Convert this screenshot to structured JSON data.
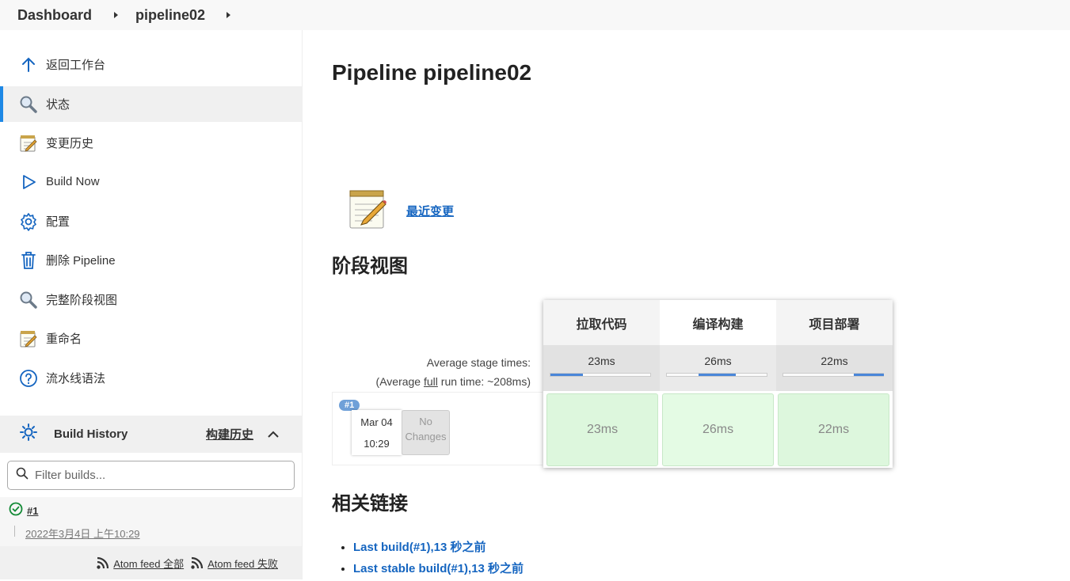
{
  "breadcrumb": {
    "items": [
      "Dashboard",
      "pipeline02"
    ]
  },
  "sidebar": {
    "items": [
      {
        "label": "返回工作台",
        "icon": "arrow-up-icon"
      },
      {
        "label": "状态",
        "icon": "magnifier-icon"
      },
      {
        "label": "变更历史",
        "icon": "notepad-icon"
      },
      {
        "label": "Build Now",
        "icon": "play-icon"
      },
      {
        "label": "配置",
        "icon": "gear-icon"
      },
      {
        "label": "删除 Pipeline",
        "icon": "trash-icon"
      },
      {
        "label": "完整阶段视图",
        "icon": "magnifier-icon"
      },
      {
        "label": "重命名",
        "icon": "notepad-icon"
      },
      {
        "label": "流水线语法",
        "icon": "help-icon"
      }
    ],
    "build_history": {
      "title": "Build History",
      "trend_label": "构建历史",
      "filter_placeholder": "Filter builds...",
      "builds": [
        {
          "number": "#1",
          "date": "2022年3月4日 上午10:29",
          "status": "success"
        }
      ],
      "feed_all": "Atom feed 全部",
      "feed_failed": "Atom feed 失败"
    }
  },
  "main": {
    "title": "Pipeline pipeline02",
    "recent_changes": "最近变更",
    "stage_view_title": "阶段视图",
    "avg_stage_times": "Average stage times:",
    "avg_full_prefix": "(Average ",
    "avg_full_word": "full",
    "avg_full_suffix": " run time: ~208ms)",
    "stages": [
      {
        "name": "拉取代码",
        "avg": "23ms",
        "run": "23ms"
      },
      {
        "name": "编译构建",
        "avg": "26ms",
        "run": "26ms"
      },
      {
        "name": "项目部署",
        "avg": "22ms",
        "run": "22ms"
      }
    ],
    "run": {
      "badge": "#1",
      "date": "Mar 04",
      "time": "10:29",
      "changes_line1": "No",
      "changes_line2": "Changes"
    },
    "related_links_title": "相关链接",
    "related_links": [
      "Last build(#1),13 秒之前",
      "Last stable build(#1),13 秒之前"
    ]
  },
  "colors": {
    "accent": "#1e88e5",
    "link": "#1565c0",
    "stage_success": "#ddf7dd",
    "progress": "#4a86d8"
  }
}
